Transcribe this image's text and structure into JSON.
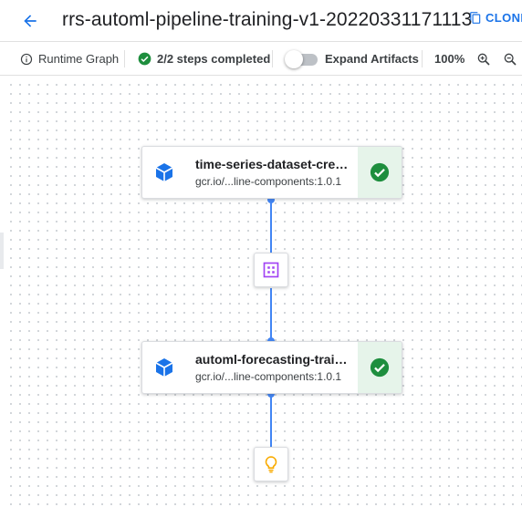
{
  "header": {
    "title": "rrs-automl-pipeline-training-v1-20220331171113",
    "clone_label": "CLONE"
  },
  "toolbar": {
    "runtime_graph_label": "Runtime Graph",
    "steps_label": "2/2 steps completed",
    "expand_artifacts_label": "Expand Artifacts",
    "expand_artifacts_on": false,
    "zoom_level": "100%"
  },
  "graph": {
    "nodes": [
      {
        "name": "time-series-dataset-create",
        "image": "gcr.io/...line-components:1.0.1",
        "status": "succeeded"
      },
      {
        "name": "automl-forecasting-training-job",
        "image": "gcr.io/...line-components:1.0.1",
        "status": "succeeded"
      }
    ],
    "artifacts": [
      {
        "kind": "dataset",
        "icon": "dataset-icon"
      },
      {
        "kind": "model",
        "icon": "lightbulb-icon"
      }
    ]
  },
  "colors": {
    "accent": "#1a73e8",
    "edge": "#4285f4",
    "success": "#1e8e3e",
    "success_bg": "#e6f4ea",
    "dataset": "#a142f4",
    "model": "#f9ab00"
  }
}
